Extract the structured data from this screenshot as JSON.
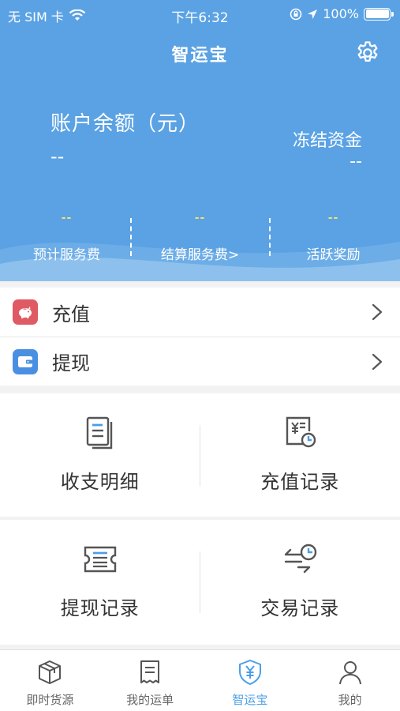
{
  "status_bar": {
    "carrier": "无 SIM 卡",
    "time": "下午6:32",
    "battery": "100%"
  },
  "header": {
    "title": "智运宝"
  },
  "balance": {
    "label": "账户余额（元）",
    "value": "--"
  },
  "frozen": {
    "label": "冻结资金",
    "value": "--"
  },
  "stats": [
    {
      "value": "--",
      "label": "预计服务费"
    },
    {
      "value": "--",
      "label": "结算服务费>"
    },
    {
      "value": "--",
      "label": "活跃奖励"
    }
  ],
  "list": [
    {
      "label": "充值",
      "icon": "piggy-bank-icon",
      "color": "#e05a63"
    },
    {
      "label": "提现",
      "icon": "wallet-icon",
      "color": "#4a90e2"
    }
  ],
  "grid": [
    {
      "label": "收支明细",
      "icon": "document-list-icon"
    },
    {
      "label": "充值记录",
      "icon": "receipt-clock-icon"
    },
    {
      "label": "提现记录",
      "icon": "ticket-icon"
    },
    {
      "label": "交易记录",
      "icon": "transfer-clock-icon"
    }
  ],
  "tabs": [
    {
      "label": "即时货源",
      "icon": "package-icon",
      "active": false
    },
    {
      "label": "我的运单",
      "icon": "waybill-icon",
      "active": false
    },
    {
      "label": "智运宝",
      "icon": "shield-yuan-icon",
      "active": true
    },
    {
      "label": "我的",
      "icon": "user-icon",
      "active": false
    }
  ],
  "colors": {
    "header_bg": "#5aa2e4",
    "accent": "#4a9ee8",
    "stat_value": "#f5e06a"
  }
}
